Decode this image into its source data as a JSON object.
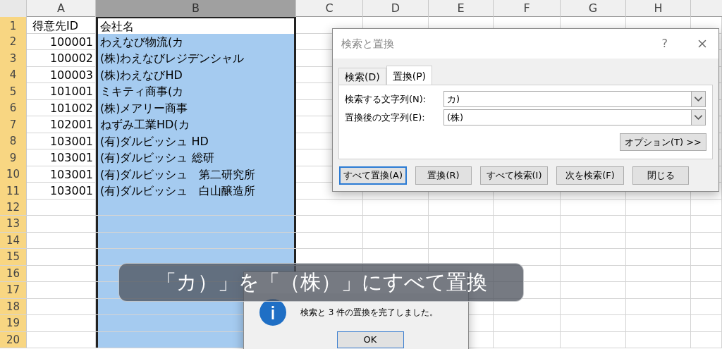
{
  "sheet": {
    "columns": [
      {
        "label": "A",
        "selected": false
      },
      {
        "label": "B",
        "selected": true
      },
      {
        "label": "C",
        "selected": false
      },
      {
        "label": "D",
        "selected": false
      },
      {
        "label": "E",
        "selected": false
      },
      {
        "label": "F",
        "selected": false
      },
      {
        "label": "G",
        "selected": false
      },
      {
        "label": "H",
        "selected": false
      }
    ],
    "rows": [
      {
        "number": "1",
        "id": "得意先ID",
        "name": "会社名",
        "active": true
      },
      {
        "number": "2",
        "id": "100001",
        "name": "わえなび物流(カ",
        "active": false
      },
      {
        "number": "3",
        "id": "100002",
        "name": "(株)わえなびレジデンシャル",
        "active": false
      },
      {
        "number": "4",
        "id": "100003",
        "name": "(株)わえなびHD",
        "active": false
      },
      {
        "number": "5",
        "id": "101001",
        "name": "ミキティ商事(カ",
        "active": false
      },
      {
        "number": "6",
        "id": "101002",
        "name": "(株)メアリー商事",
        "active": false
      },
      {
        "number": "7",
        "id": "102001",
        "name": "ねずみ工業HD(カ",
        "active": false
      },
      {
        "number": "8",
        "id": "103001",
        "name": "(有)ダルビッシュ HD",
        "active": false
      },
      {
        "number": "9",
        "id": "103001",
        "name": "(有)ダルビッシュ 総研",
        "active": false
      },
      {
        "number": "10",
        "id": "103001",
        "name": "(有)ダルビッシュ　第二研究所",
        "active": false
      },
      {
        "number": "11",
        "id": "103001",
        "name": "(有)ダルビッシュ　白山醸造所",
        "active": false
      },
      {
        "number": "12",
        "active": false
      },
      {
        "number": "13",
        "active": false
      },
      {
        "number": "14",
        "active": false
      },
      {
        "number": "15",
        "active": false
      },
      {
        "number": "16",
        "active": false
      },
      {
        "number": "17",
        "active": false
      },
      {
        "number": "18",
        "active": false
      },
      {
        "number": "19",
        "active": false
      },
      {
        "number": "20",
        "active": false
      }
    ]
  },
  "find_dialog": {
    "title": "検索と置換",
    "help": "?",
    "tabs": [
      {
        "label": "検索(D)",
        "selected": false
      },
      {
        "label": "置換(P)",
        "selected": true
      }
    ],
    "fields": [
      {
        "label": "検索する文字列(N):",
        "value": "カ)"
      },
      {
        "label": "置換後の文字列(E):",
        "value": "(株)"
      }
    ],
    "options_button": "オプション(T) >>",
    "buttons": [
      {
        "label": "すべて置換(A)",
        "default": true
      },
      {
        "label": "置換(R)",
        "default": false
      },
      {
        "label": "すべて検索(I)",
        "default": false
      },
      {
        "label": "次を検索(F)",
        "default": false
      },
      {
        "label": "閉じる",
        "default": false
      }
    ]
  },
  "message_box": {
    "message": "検索と 3 件の置換を完了しました。",
    "ok": "OK"
  },
  "caption": "「カ）」を「（株）」にすべて置換"
}
